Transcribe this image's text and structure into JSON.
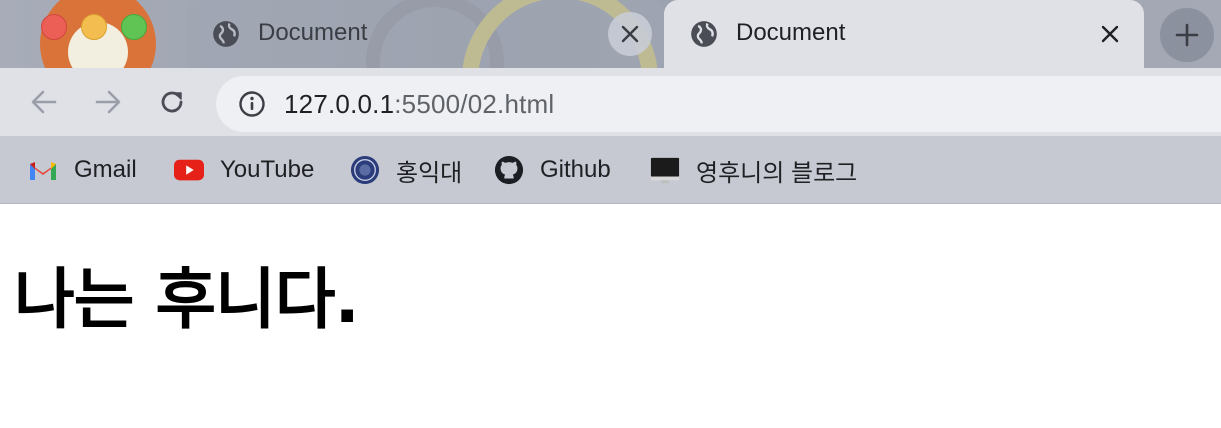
{
  "tabs": [
    {
      "title": "Document",
      "active": false
    },
    {
      "title": "Document",
      "active": true
    }
  ],
  "address_bar": {
    "host": "127.0.0.1",
    "port_path": ":5500/02.html"
  },
  "bookmarks": [
    {
      "label": "Gmail",
      "icon": "gmail-icon"
    },
    {
      "label": "YouTube",
      "icon": "youtube-icon"
    },
    {
      "label": "홍익대",
      "icon": "hongik-seal-icon"
    },
    {
      "label": "Github",
      "icon": "github-icon"
    },
    {
      "label": "영후니의 블로그",
      "icon": "monitor-icon"
    }
  ],
  "page": {
    "heading": "나는 후니다."
  },
  "colors": {
    "traffic_close": "#ec5f57",
    "traffic_min": "#f4bd4f",
    "traffic_max": "#5fc453",
    "youtube": "#e62117"
  }
}
